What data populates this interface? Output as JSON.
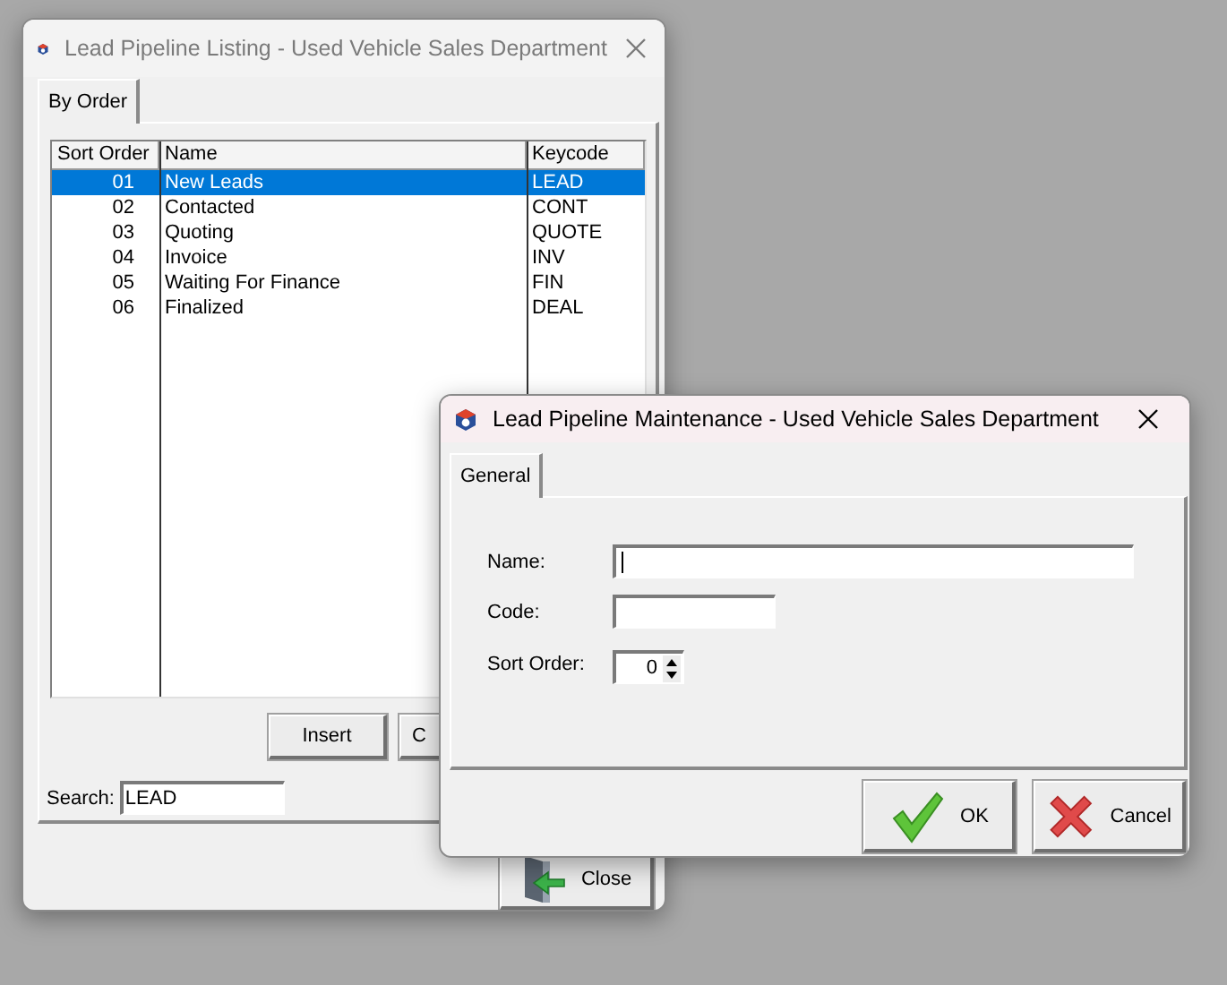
{
  "listing_window": {
    "title": "Lead Pipeline Listing - Used Vehicle Sales Department",
    "active": false,
    "tabs": [
      {
        "label": "By Order",
        "selected": true
      }
    ],
    "table": {
      "columns": [
        "Sort Order",
        "Name",
        "Keycode"
      ],
      "rows": [
        {
          "sort_order": "01",
          "name": "New Leads",
          "keycode": "LEAD",
          "selected": true
        },
        {
          "sort_order": "02",
          "name": "Contacted",
          "keycode": "CONT",
          "selected": false
        },
        {
          "sort_order": "03",
          "name": "Quoting",
          "keycode": "QUOTE",
          "selected": false
        },
        {
          "sort_order": "04",
          "name": "Invoice",
          "keycode": "INV",
          "selected": false
        },
        {
          "sort_order": "05",
          "name": "Waiting For Finance",
          "keycode": "FIN",
          "selected": false
        },
        {
          "sort_order": "06",
          "name": "Finalized",
          "keycode": "DEAL",
          "selected": false
        }
      ]
    },
    "buttons": [
      "Insert",
      "C"
    ],
    "search": {
      "label": "Search:",
      "value": "LEAD"
    },
    "close_button": "Close"
  },
  "maintenance_dialog": {
    "title": "Lead Pipeline Maintenance - Used Vehicle Sales Department",
    "active": true,
    "tabs": [
      {
        "label": "General",
        "selected": true
      }
    ],
    "fields": [
      {
        "kind": "long_text",
        "label": "Name:",
        "focused": true
      },
      {
        "kind": "short_text",
        "label": "Code:"
      },
      {
        "kind": "spinner",
        "label": "Sort Order:",
        "value": "0"
      }
    ],
    "buttons": [
      {
        "kind": "ok",
        "label": "OK"
      },
      {
        "kind": "cancel",
        "label": "Cancel"
      }
    ]
  }
}
